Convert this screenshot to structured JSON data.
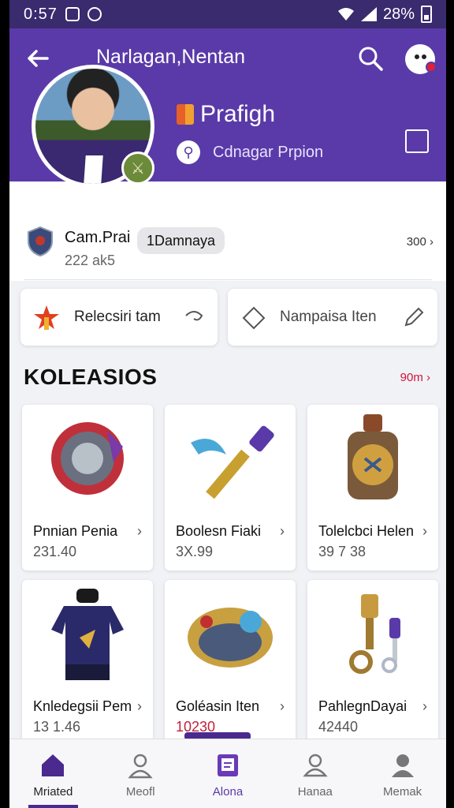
{
  "status": {
    "time": "0:57",
    "battery": "28%"
  },
  "header": {
    "title": "Narlagan,Nentan",
    "profile_name": "Prafigh",
    "profile_subtitle": "Cdnagar Prpion"
  },
  "account": {
    "name": "Cam.Prai",
    "pill": "1Damnaya",
    "count": "222 ak5",
    "more": "300"
  },
  "actions": [
    {
      "label": "Relecsiri tam"
    },
    {
      "label": "Nampaisa Iten"
    }
  ],
  "collection": {
    "title": "KOLEASIOS",
    "more": "90m",
    "items": [
      {
        "name": "Pnnian Penia",
        "price": "231.40",
        "icon": "shield-icon"
      },
      {
        "name": "Boolesn Fiaki",
        "price": "3X.99",
        "icon": "wand-icon"
      },
      {
        "name": "Tolelcbci Helen",
        "price": "39 7 38",
        "icon": "amulet-icon"
      },
      {
        "name": "Knledegsii Pem",
        "price": "13 1.46",
        "icon": "jersey-icon"
      },
      {
        "name": "Goléasin Iten",
        "price": "10230",
        "icon": "ring-icon"
      },
      {
        "name": "PahlegnDayai",
        "price": "42440",
        "icon": "keys-icon"
      }
    ]
  },
  "nav": [
    {
      "label": "Mriated",
      "icon": "home-icon"
    },
    {
      "label": "Meofl",
      "icon": "profile-icon"
    },
    {
      "label": "Alona",
      "icon": "clipboard-icon"
    },
    {
      "label": "Hanaa",
      "icon": "user-icon"
    },
    {
      "label": "Memak",
      "icon": "person-icon"
    }
  ],
  "colors": {
    "brand": "#5a3aa8",
    "accent": "#d0143c",
    "status_bar": "#3a2a6e"
  }
}
